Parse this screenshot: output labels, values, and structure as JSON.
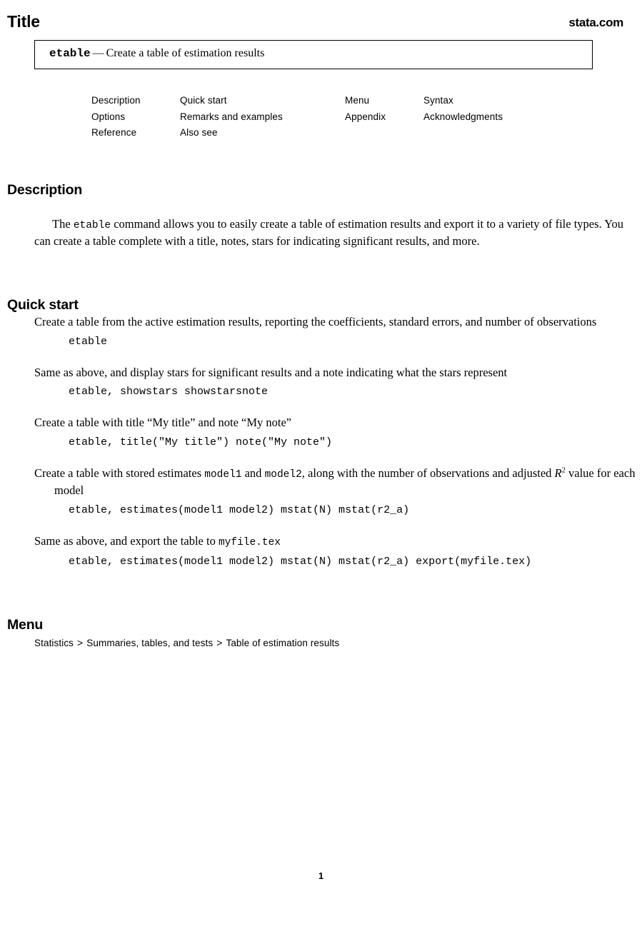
{
  "header": {
    "title": "Title",
    "site_link": "stata.com"
  },
  "title_box": {
    "command": "etable",
    "dash": "—",
    "description": "Create a table of estimation results"
  },
  "nav": {
    "rows": [
      {
        "col1": "Description",
        "col2": "Quick start",
        "col3": "Menu",
        "col4": "Syntax"
      },
      {
        "col1": "Options",
        "col2": "Remarks and examples",
        "col3": "Appendix",
        "col4": "Acknowledgments"
      },
      {
        "col1": "Reference",
        "col2": "Also see",
        "col3": "",
        "col4": ""
      }
    ]
  },
  "sections": {
    "description": {
      "heading": "Description",
      "body_part1": "The ",
      "body_code": "etable",
      "body_part2": " command allows you to easily create a table of estimation results and export it to a variety of file types. You can create a table complete with a title, notes, stars for indicating significant results, and more."
    },
    "quick_start": {
      "heading": "Quick start",
      "entries": [
        {
          "text": "Create a table from the active estimation results, reporting the coefficients, standard errors, and number of observations",
          "code": "etable"
        },
        {
          "text": "Same as above, and display stars for significant results and a note indicating what the stars represent",
          "code": "etable, showstars showstarsnote"
        },
        {
          "text": "Create a table with title “My title” and note “My note”",
          "code": "etable, title(\"My title\") note(\"My note\")"
        },
        {
          "text_a": "Create a table with stored estimates ",
          "text_code_a": "model1",
          "text_b": " and ",
          "text_code_b": "model2",
          "text_c": ", along with the number of observations and adjusted ",
          "math_r": "R",
          "math_sup": "2",
          "text_d": " value for each model",
          "code": "etable, estimates(model1 model2) mstat(N) mstat(r2_a)"
        },
        {
          "text_a": "Same as above, and export the table to ",
          "text_code_a": "myfile.tex",
          "code": "etable, estimates(model1 model2) mstat(N) mstat(r2_a) export(myfile.tex)"
        }
      ]
    },
    "menu": {
      "heading": "Menu",
      "path_items": [
        "Statistics",
        "Summaries, tables, and tests",
        "Table of estimation results"
      ],
      "separator": ">"
    }
  },
  "footer": {
    "page_number": "1"
  }
}
